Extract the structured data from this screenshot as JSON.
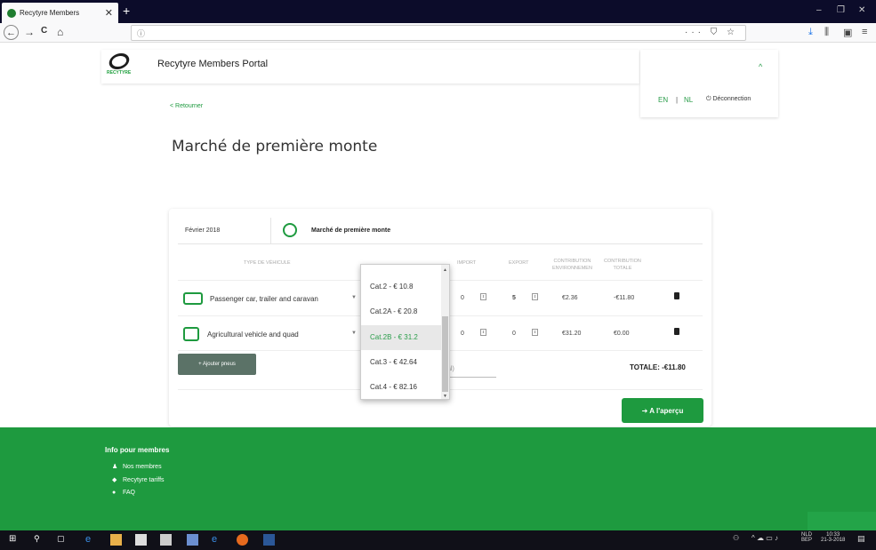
{
  "browser": {
    "tab_title": "Recytyre Members",
    "tab_close": "✕",
    "new_tab": "+",
    "url_info": "ⓘ",
    "url_actions": "··· ⛉ ☆",
    "nav": {
      "back": "←",
      "forward": "→",
      "reload": "C",
      "home": "⌂"
    },
    "window_controls": {
      "minimize": "–",
      "restore": "❐",
      "close": "✕"
    },
    "toolbar_icons": {
      "download": "⤓",
      "library": "⫼",
      "sidebar": "▣",
      "menu": "≡"
    }
  },
  "header": {
    "logo_text": "RECYTYRE",
    "portal_title": "Recytyre Members Portal",
    "chevron": "^",
    "lang_en": "EN",
    "lang_sep": "|",
    "lang_nl": "NL",
    "logout": "Déconnection"
  },
  "page": {
    "back_link": "< Retourner",
    "title": "Marché de première monte"
  },
  "card": {
    "month": "Février 2018",
    "market_title": "Marché de première monte",
    "columns": {
      "type": "TYPE DE VÉHICULE",
      "import": "IMPORT",
      "export": "EXPORT",
      "contrib_env_1": "CONTRIBUTION",
      "contrib_env_2": "ENVIRONNEMEN",
      "contrib_tot_1": "CONTRIBUTION",
      "contrib_tot_2": "TOTALE"
    },
    "rows": [
      {
        "vehicle": "Passenger car, trailer and caravan",
        "import": "0",
        "export": "5",
        "contrib_env": "€2.36",
        "contrib_total": "-€11.80"
      },
      {
        "vehicle": "Agricultural vehicle and quad",
        "import": "0",
        "export": "0",
        "contrib_env": "€31.20",
        "contrib_total": "€0.00"
      }
    ],
    "add_button": "+ Ajouter pneus",
    "al_text": "al)",
    "total": "TOTALE: -€11.80",
    "preview_button": "➔ A l'aperçu"
  },
  "dropdown": {
    "options": [
      "Cat.2 - € 10.8",
      "Cat.2A - € 20.8",
      "Cat.2B - € 31.2",
      "Cat.3 - € 42.64",
      "Cat.4 - € 82.16"
    ],
    "selected_index": 2
  },
  "footer": {
    "title": "Info pour membres",
    "links": [
      "Nos membres",
      "Recytyre tariffs",
      "FAQ"
    ]
  },
  "taskbar": {
    "lang_1": "NLD",
    "lang_2": "BEP",
    "time": "10:33",
    "date": "21-3-2018"
  },
  "colors": {
    "brand_green": "#1e9a3f",
    "dark_chrome": "#0c0c2a"
  }
}
